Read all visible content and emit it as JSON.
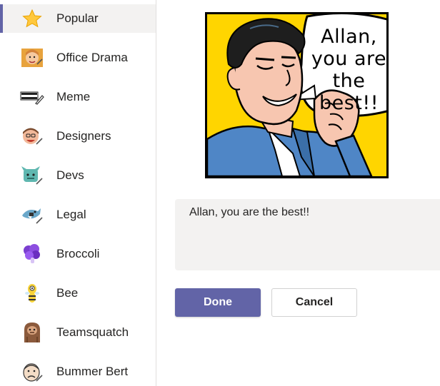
{
  "sidebar": {
    "items": [
      {
        "label": "Popular",
        "icon": "star-icon",
        "selected": true
      },
      {
        "label": "Office Drama",
        "icon": "office-drama-icon",
        "selected": false
      },
      {
        "label": "Meme",
        "icon": "meme-icon",
        "selected": false
      },
      {
        "label": "Designers",
        "icon": "designers-icon",
        "selected": false
      },
      {
        "label": "Devs",
        "icon": "devs-icon",
        "selected": false
      },
      {
        "label": "Legal",
        "icon": "legal-icon",
        "selected": false
      },
      {
        "label": "Broccoli",
        "icon": "broccoli-icon",
        "selected": false
      },
      {
        "label": "Bee",
        "icon": "bee-icon",
        "selected": false
      },
      {
        "label": "Teamsquatch",
        "icon": "teamsquatch-icon",
        "selected": false
      },
      {
        "label": "Bummer Bert",
        "icon": "bummer-bert-icon",
        "selected": false
      }
    ]
  },
  "preview": {
    "bubble_lines": [
      "Allan,",
      "you are",
      "the best!!"
    ]
  },
  "caption": {
    "value": "Allan, you are the best!!"
  },
  "actions": {
    "done_label": "Done",
    "cancel_label": "Cancel"
  },
  "colors": {
    "accent": "#6264a7",
    "selected_bg": "#f3f2f1",
    "star": "#ffc83d",
    "meme_background": "#ffd500"
  }
}
